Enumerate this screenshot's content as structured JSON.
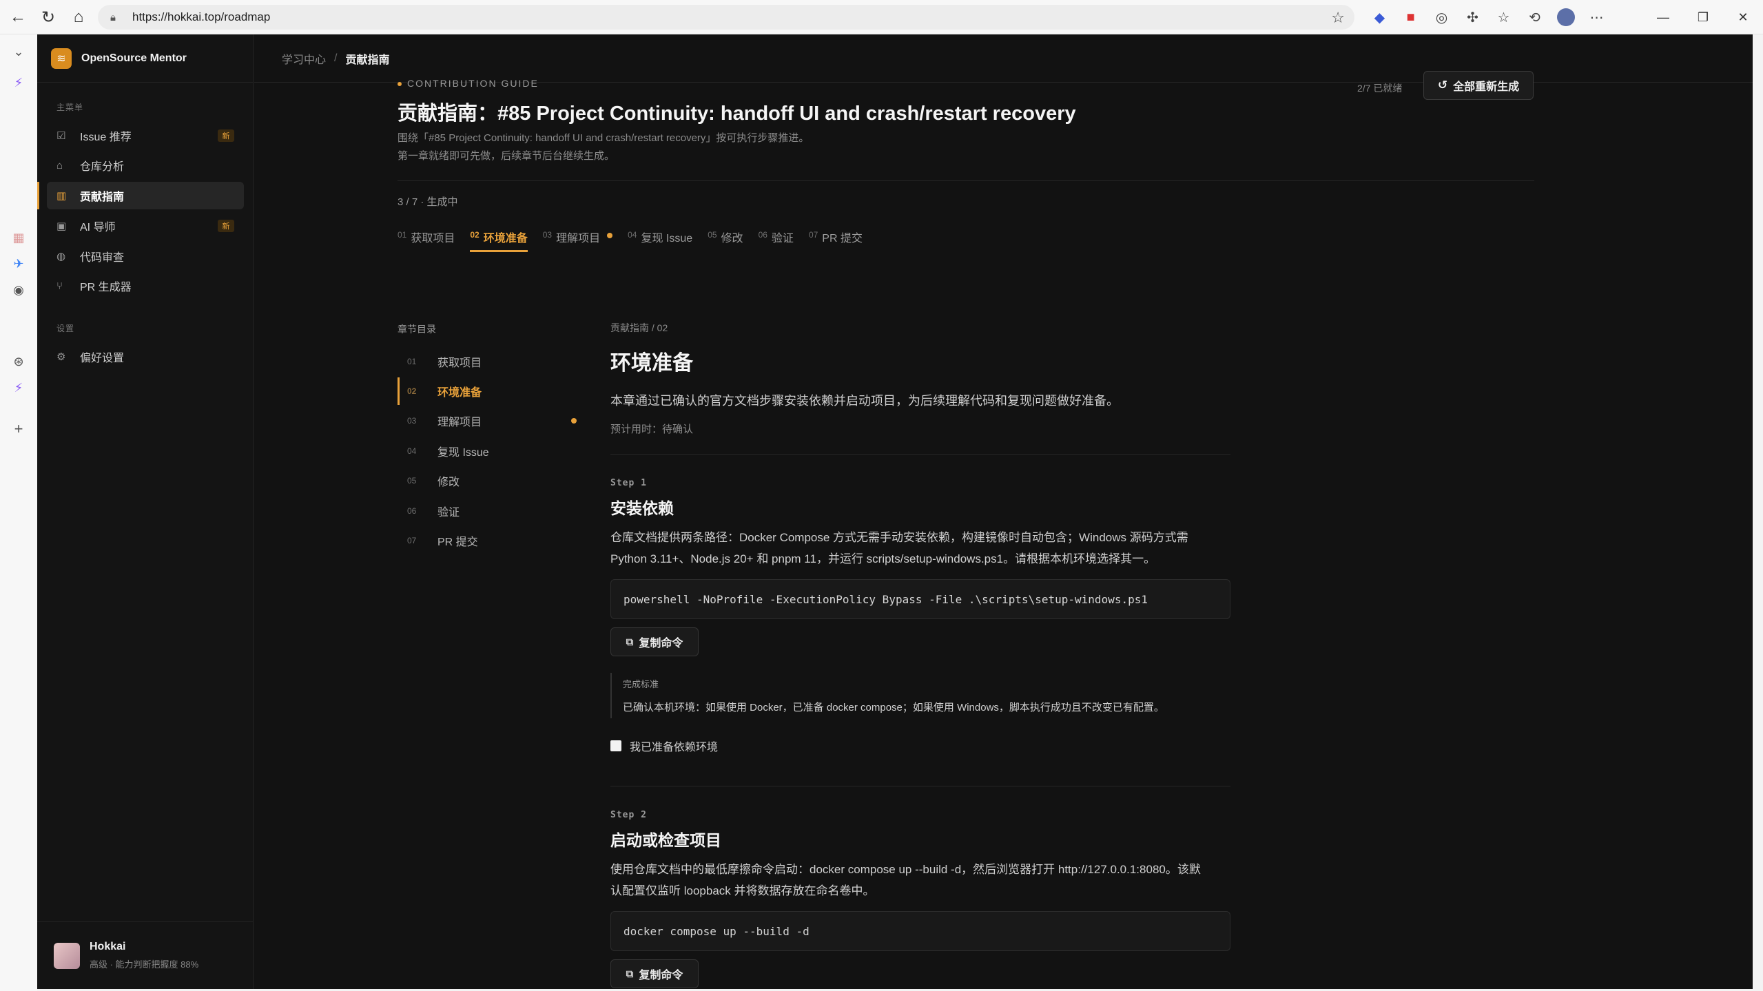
{
  "browser": {
    "url": "https://hokkai.top/roadmap"
  },
  "sidebar": {
    "brand": "OpenSource Mentor",
    "main_label": "主菜单",
    "settings_label": "设置",
    "items": [
      {
        "label": "Issue 推荐",
        "badge": "新"
      },
      {
        "label": "仓库分析"
      },
      {
        "label": "贡献指南"
      },
      {
        "label": "AI 导师",
        "badge": "新"
      },
      {
        "label": "代码审查"
      },
      {
        "label": "PR 生成器"
      }
    ],
    "settings_items": [
      {
        "label": "偏好设置"
      }
    ],
    "user": {
      "name": "Hokkai",
      "sub": "高级 · 能力判断把握度 88%"
    }
  },
  "topbar": {
    "crumb_root": "学习中心",
    "crumb_sep": "/",
    "crumb_current": "贡献指南"
  },
  "header": {
    "eyebrow": "CONTRIBUTION GUIDE",
    "title": "贡献指南：#85 Project Continuity: handoff UI and crash/restart recovery",
    "subtitle_1": "围绕「#85 Project Continuity: handoff UI and crash/restart recovery」按可执行步骤推进。",
    "subtitle_2": "第一章就绪即可先做，后续章节后台继续生成。",
    "ready": "2/7 已就绪",
    "regen_label": "全部重新生成",
    "progress": "3 / 7 · 生成中"
  },
  "tabs": [
    {
      "num": "01",
      "label": "获取项目"
    },
    {
      "num": "02",
      "label": "环境准备"
    },
    {
      "num": "03",
      "label": "理解项目"
    },
    {
      "num": "04",
      "label": "复现 Issue"
    },
    {
      "num": "05",
      "label": "修改"
    },
    {
      "num": "06",
      "label": "验证"
    },
    {
      "num": "07",
      "label": "PR 提交"
    }
  ],
  "toc": {
    "title": "章节目录",
    "items": [
      {
        "num": "01",
        "label": "获取项目"
      },
      {
        "num": "02",
        "label": "环境准备"
      },
      {
        "num": "03",
        "label": "理解项目"
      },
      {
        "num": "04",
        "label": "复现 Issue"
      },
      {
        "num": "05",
        "label": "修改"
      },
      {
        "num": "06",
        "label": "验证"
      },
      {
        "num": "07",
        "label": "PR 提交"
      }
    ]
  },
  "chapter": {
    "crumb": "贡献指南 / 02",
    "title": "环境准备",
    "desc": "本章通过已确认的官方文档步骤安装依赖并启动项目，为后续理解代码和复现问题做好准备。",
    "time": "预计用时：待确认",
    "steps": [
      {
        "label": "Step 1",
        "title": "安装依赖",
        "desc_1": "仓库文档提供两条路径：Docker Compose 方式无需手动安装依赖，构建镜像时自动包含；Windows 源码方式需",
        "desc_2": "Python 3.11+、Node.js 20+ 和 pnpm 11，并运行 scripts/setup-windows.ps1。请根据本机环境选择其一。",
        "cmd": "powershell -NoProfile -ExecutionPolicy Bypass -File .\\scripts\\setup-windows.ps1",
        "copy_label": "复制命令",
        "criteria_label": "完成标准",
        "criteria": "已确认本机环境：如果使用 Docker，已准备 docker compose；如果使用 Windows，脚本执行成功且不改变已有配置。",
        "check_label": "我已准备依赖环境"
      },
      {
        "label": "Step 2",
        "title": "启动或检查项目",
        "desc_1": "使用仓库文档中的最低摩擦命令启动：docker compose up --build -d，然后浏览器打开 http://127.0.0.1:8080。该默",
        "desc_2": "认配置仅监听 loopback 并将数据存放在命名卷中。",
        "cmd": "docker compose up --build -d",
        "copy_label": "复制命令"
      }
    ]
  },
  "colors": {
    "accent": "#e8a13a",
    "background": "#121212",
    "sidebar": "#141414"
  }
}
